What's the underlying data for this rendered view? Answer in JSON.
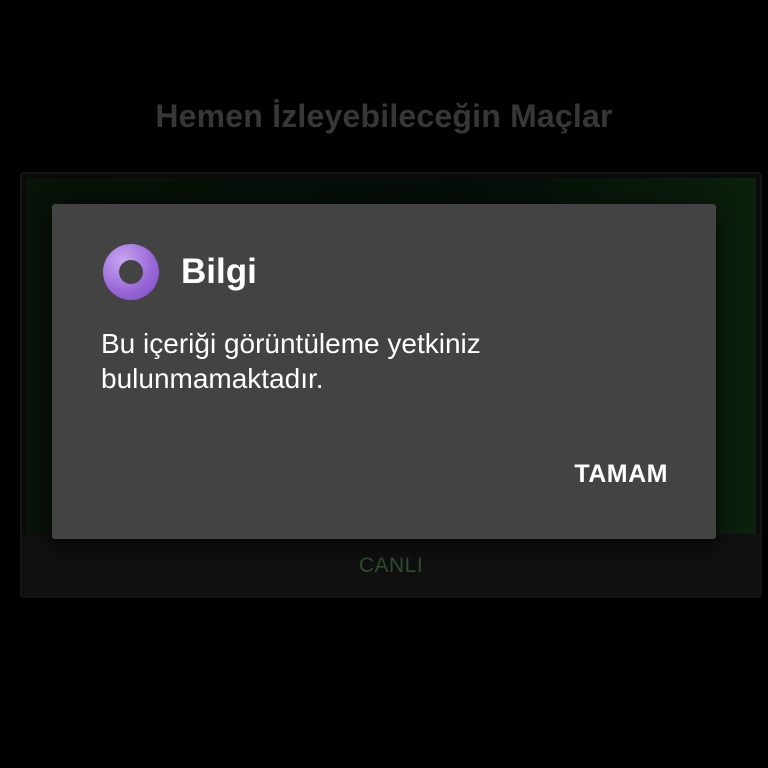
{
  "page": {
    "title": "Hemen İzleyebileceğin Maçlar"
  },
  "match_card": {
    "thumbnail_caption": "",
    "status_label": "CANLI"
  },
  "dialog": {
    "icon": "app-ring-icon",
    "title": "Bilgi",
    "message": "Bu içeriği görüntüleme yetkiniz bulunmamaktadır.",
    "ok_button_label": "TAMAM",
    "colors": {
      "background": "#434343",
      "icon_accent": "#9a6ad8"
    }
  }
}
